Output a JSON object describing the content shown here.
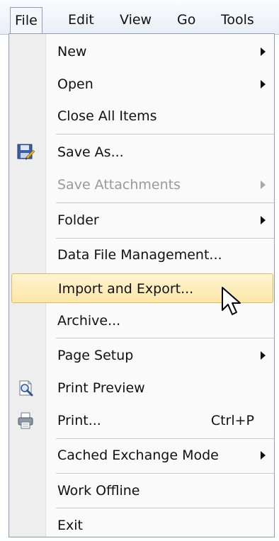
{
  "menubar": {
    "items": [
      {
        "label": "File",
        "active": true
      },
      {
        "label": "Edit",
        "active": false
      },
      {
        "label": "View",
        "active": false
      },
      {
        "label": "Go",
        "active": false
      },
      {
        "label": "Tools",
        "active": false
      }
    ]
  },
  "menu": {
    "items": [
      {
        "label": "New",
        "submenu": true
      },
      {
        "label": "Open",
        "submenu": true
      },
      {
        "label": "Close All Items"
      },
      {
        "label": "Save As...",
        "icon": "save-as-icon"
      },
      {
        "label": "Save Attachments",
        "submenu": true,
        "disabled": true
      },
      {
        "label": "Folder",
        "submenu": true
      },
      {
        "label": "Data File Management..."
      },
      {
        "label": "Import and Export...",
        "highlighted": true
      },
      {
        "label": "Archive..."
      },
      {
        "label": "Page Setup",
        "submenu": true
      },
      {
        "label": "Print Preview",
        "icon": "print-preview-icon"
      },
      {
        "label": "Print...",
        "icon": "printer-icon",
        "shortcut": "Ctrl+P"
      },
      {
        "label": "Cached Exchange Mode",
        "submenu": true
      },
      {
        "label": "Work Offline"
      },
      {
        "label": "Exit"
      }
    ]
  },
  "colors": {
    "highlight": "#fde7a8",
    "highlight_border": "#e3b95c",
    "disabled_text": "#9a9a9a"
  }
}
